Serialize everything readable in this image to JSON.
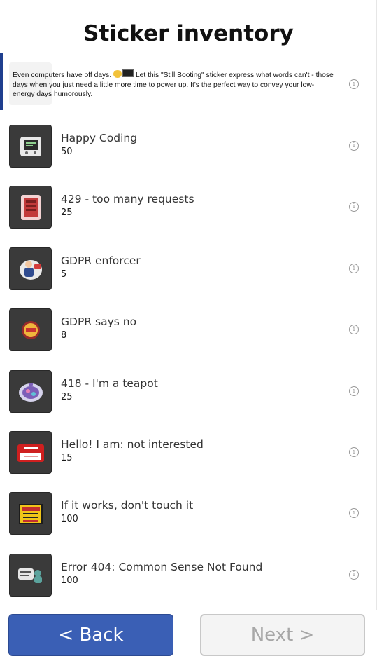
{
  "page": {
    "title": "Sticker inventory"
  },
  "selected_item": {
    "description_before_emoji": "Even computers have off days.",
    "emoji_icons": [
      "sleepy-face-icon",
      "computer-screen-icon"
    ],
    "description_after_emoji": "Let this \"Still Booting\" sticker express what words can't - those days when you just need a little more time to power up. It's the perfect way to convey your low-energy days humorously."
  },
  "items": [
    {
      "name": "Happy Coding",
      "quantity": "50",
      "icon": "happy-coding-sticker-icon"
    },
    {
      "name": "429 - too many requests",
      "quantity": "25",
      "icon": "429-sticker-icon"
    },
    {
      "name": "GDPR enforcer",
      "quantity": "5",
      "icon": "gdpr-enforcer-sticker-icon"
    },
    {
      "name": "GDPR says no",
      "quantity": "8",
      "icon": "gdpr-says-no-sticker-icon"
    },
    {
      "name": "418 - I'm a teapot",
      "quantity": "25",
      "icon": "teapot-sticker-icon"
    },
    {
      "name": "Hello! I am: not interested",
      "quantity": "15",
      "icon": "hello-sticker-icon"
    },
    {
      "name": "If it works, don't touch it",
      "quantity": "100",
      "icon": "warning-sign-sticker-icon"
    },
    {
      "name": "Error 404: Common Sense Not Found",
      "quantity": "100",
      "icon": "error-404-sticker-icon"
    }
  ],
  "info_icon": "info-icon",
  "info_glyph": "i",
  "buttons": {
    "back_label": "< Back",
    "next_label": "Next >"
  },
  "colors": {
    "accent": "#3a5fb5",
    "selection_bar": "#1f3f8f",
    "disabled_text": "#a7a7a7"
  }
}
